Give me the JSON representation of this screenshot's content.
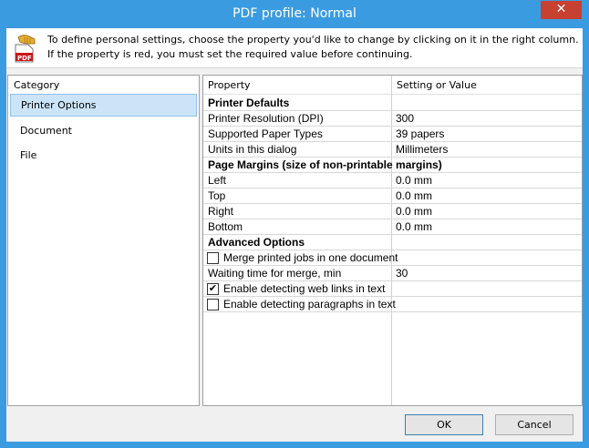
{
  "window": {
    "title": "PDF profile: Normal",
    "close_glyph": "✕"
  },
  "intro": {
    "icon": "pdf-hand-icon",
    "text": "To define personal settings, choose the property you'd like to change by clicking on it in the right column. If the property is red, you must set the required value before continuing."
  },
  "category": {
    "header": "Category",
    "items": [
      {
        "label": "Printer Options",
        "selected": true
      },
      {
        "label": "Document",
        "selected": false
      },
      {
        "label": "File",
        "selected": false
      }
    ]
  },
  "properties": {
    "col_property": "Property",
    "col_value": "Setting or Value",
    "rows": [
      {
        "type": "group",
        "label": "Printer Defaults"
      },
      {
        "type": "prop",
        "label": "Printer Resolution (DPI)",
        "value": "300"
      },
      {
        "type": "prop",
        "label": "Supported Paper Types",
        "value": "39 papers"
      },
      {
        "type": "prop",
        "label": "Units in this dialog",
        "value": "Millimeters"
      },
      {
        "type": "group",
        "label": "Page Margins (size of non-printable margins)"
      },
      {
        "type": "prop",
        "label": "Left",
        "value": "0.0 mm"
      },
      {
        "type": "prop",
        "label": "Top",
        "value": "0.0 mm"
      },
      {
        "type": "prop",
        "label": "Right",
        "value": "0.0 mm"
      },
      {
        "type": "prop",
        "label": "Bottom",
        "value": "0.0 mm"
      },
      {
        "type": "group",
        "label": "Advanced Options"
      },
      {
        "type": "check",
        "label": "Merge printed jobs in one document",
        "checked": false
      },
      {
        "type": "prop",
        "label": "Waiting time for merge, min",
        "value": "30"
      },
      {
        "type": "check",
        "label": "Enable detecting web links in text",
        "checked": true
      },
      {
        "type": "check",
        "label": "Enable detecting paragraphs in text",
        "checked": false
      }
    ]
  },
  "buttons": {
    "ok": "OK",
    "cancel": "Cancel"
  },
  "colors": {
    "titlebar": "#3a9be0",
    "close": "#c74030",
    "selection": "#cce4f7"
  }
}
